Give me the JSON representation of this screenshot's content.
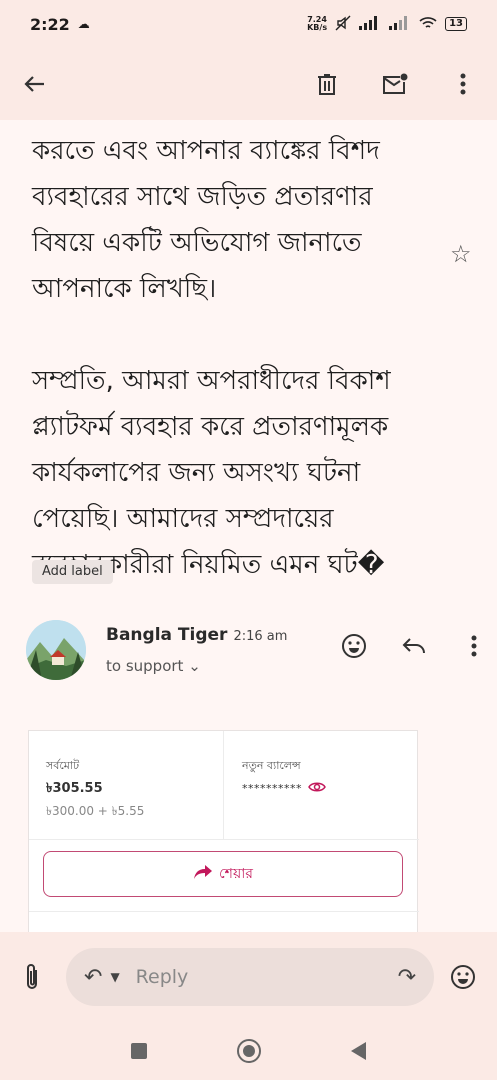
{
  "status_bar": {
    "time": "2:22",
    "netspeed_value": "7.24",
    "netspeed_unit": "KB/s",
    "battery": "13"
  },
  "app_bar": {
    "back_icon": "arrow-left-icon",
    "actions": [
      "delete-icon",
      "mark-unread-icon",
      "more-vert-icon"
    ]
  },
  "email": {
    "paragraphs": [
      "করতে এবং আপনার ব্যাঙ্কের বিশদ ব্যবহারের সাথে জড়িত প্রতারণার বিষয়ে একটি অভিযোগ জানাতে আপনাকে লিখছি।",
      "সম্প্রতি, আমরা অপরাধীদের বিকাশ প্ল্যাটফর্ম ব্যবহার করে প্রতারণামূলক কার্যকলাপের জন্য অসংখ্য ঘটনা পেয়েছি। আমাদের সম্প্রদায়ের ব্যবহারকারীরা নিয়মিত এমন ঘট�"
    ],
    "label_chip": "Add label"
  },
  "sender": {
    "name": "Bangla Tiger",
    "time": "2:16 am",
    "to": "to support"
  },
  "receipt": {
    "total_label": "সর্বমোট",
    "total_value": "৳305.55",
    "breakdown": "৳300.00 + ৳5.55",
    "balance_label": "নতুন ব্যালেন্স",
    "balance_masked": "**********",
    "share_label": "শেয়ার"
  },
  "reply_bar": {
    "reply_label": "Reply"
  },
  "colors": {
    "background": "#fff6f4",
    "bar": "#fbeae5",
    "accent": "#c2185b"
  }
}
